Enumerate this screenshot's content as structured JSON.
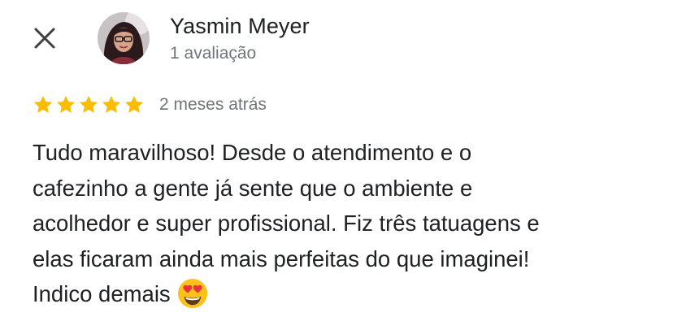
{
  "reviewer": {
    "name": "Yasmin Meyer",
    "review_count": "1 avaliação",
    "avatar_icon": "profile-photo"
  },
  "close_icon": "close-icon",
  "review": {
    "rating": 5,
    "max_rating": 5,
    "time_ago": "2 meses atrás",
    "lines": [
      "Tudo maravilhoso! Desde o atendimento e o",
      "cafezinho a gente já sente que o ambiente e",
      "acolhedor e super profissional. Fiz três tatuagens e",
      "elas ficaram ainda mais perfeitas do que imaginei!",
      "Indico demais"
    ],
    "emoji": "heart-eyes-emoji"
  },
  "colors": {
    "star": "#fbbc04",
    "secondary_text": "#70757a",
    "primary_text": "#202124"
  }
}
